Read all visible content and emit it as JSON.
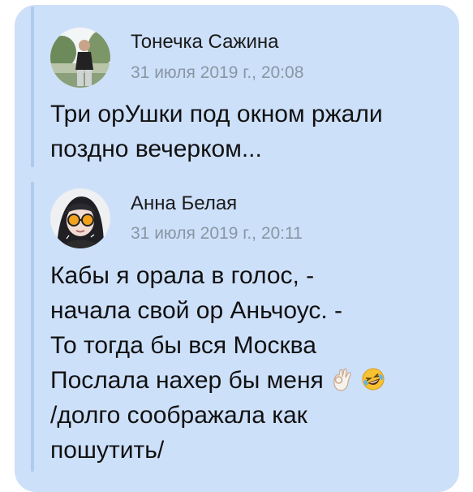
{
  "messages": [
    {
      "author": "Тонечка Сажина",
      "date": "31 июля 2019 г., 20:08",
      "avatar": "avatar-photo-person-outdoors",
      "lines": [
        "Три орУшки под окном ржали",
        "поздно вечерком..."
      ]
    },
    {
      "author": "Анна Белая",
      "date": "31 июля 2019 г., 20:11",
      "avatar": "avatar-photo-girl-sunglasses",
      "lines": [
        "Кабы я орала в голос, -",
        "начала свой ор Аньчоус. -",
        "То тогда бы вся Москва",
        "Послала нахер бы меня",
        "/долго соображала как",
        "пошутить/"
      ],
      "line4_emojis": [
        "ok-hand-icon",
        "rofl-face-icon"
      ]
    }
  ],
  "colors": {
    "bubble": "#cde0fa",
    "quote_bar": "#aecbeb",
    "date": "#8996a3"
  }
}
